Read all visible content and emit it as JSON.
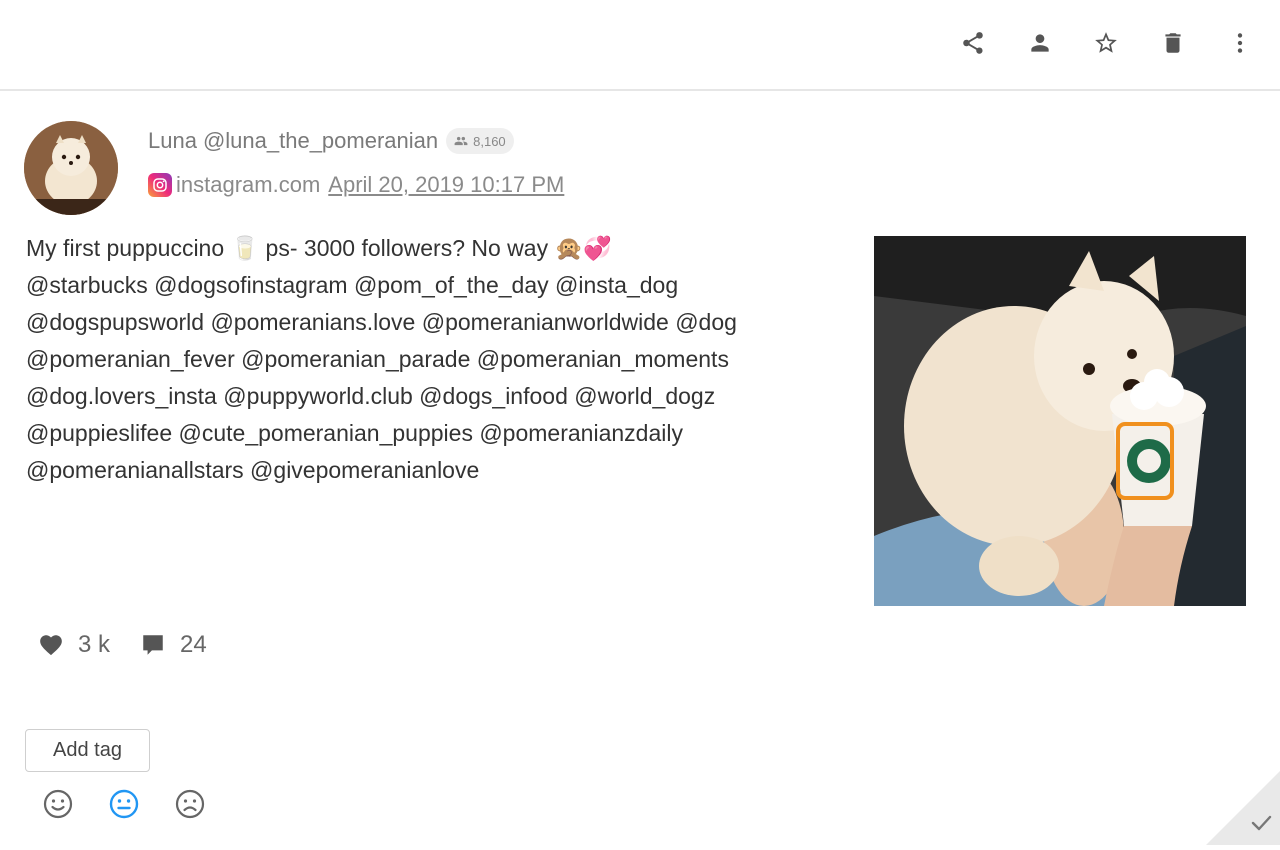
{
  "toolbar": {
    "share": "share-icon",
    "assign": "person-icon",
    "favorite": "star-icon",
    "delete": "trash-icon",
    "more": "more-vert-icon"
  },
  "post": {
    "author_name": "Luna",
    "author_handle": "@luna_the_pomeranian",
    "followers": "8,160",
    "source": "instagram.com",
    "date": "April 20, 2019 10:17 PM",
    "text_lines": [
      "My first puppuccino 🥛 ps- 3000 followers? No way 🙊💞",
      "@starbucks @dogsofinstagram @pom_of_the_day @insta_dog",
      "@dogspupsworld @pomeranians.love @pomeranianworldwide @dog",
      "@pomeranian_fever @pomeranian_parade @pomeranian_moments",
      "@dog.lovers_insta @puppyworld.club @dogs_infood @world_dogz",
      "@puppieslifee @cute_pomeranian_puppies @pomeranianzdaily",
      "@pomeranianallstars @givepomeranianlove"
    ],
    "likes": "3 k",
    "comments": "24"
  },
  "actions": {
    "add_tag_label": "Add tag",
    "sentiments": [
      "positive",
      "neutral",
      "negative"
    ],
    "selected_sentiment": "neutral"
  },
  "colors": {
    "accent": "#2196f3",
    "icon": "#555555",
    "logo_box": "#f0901e"
  }
}
